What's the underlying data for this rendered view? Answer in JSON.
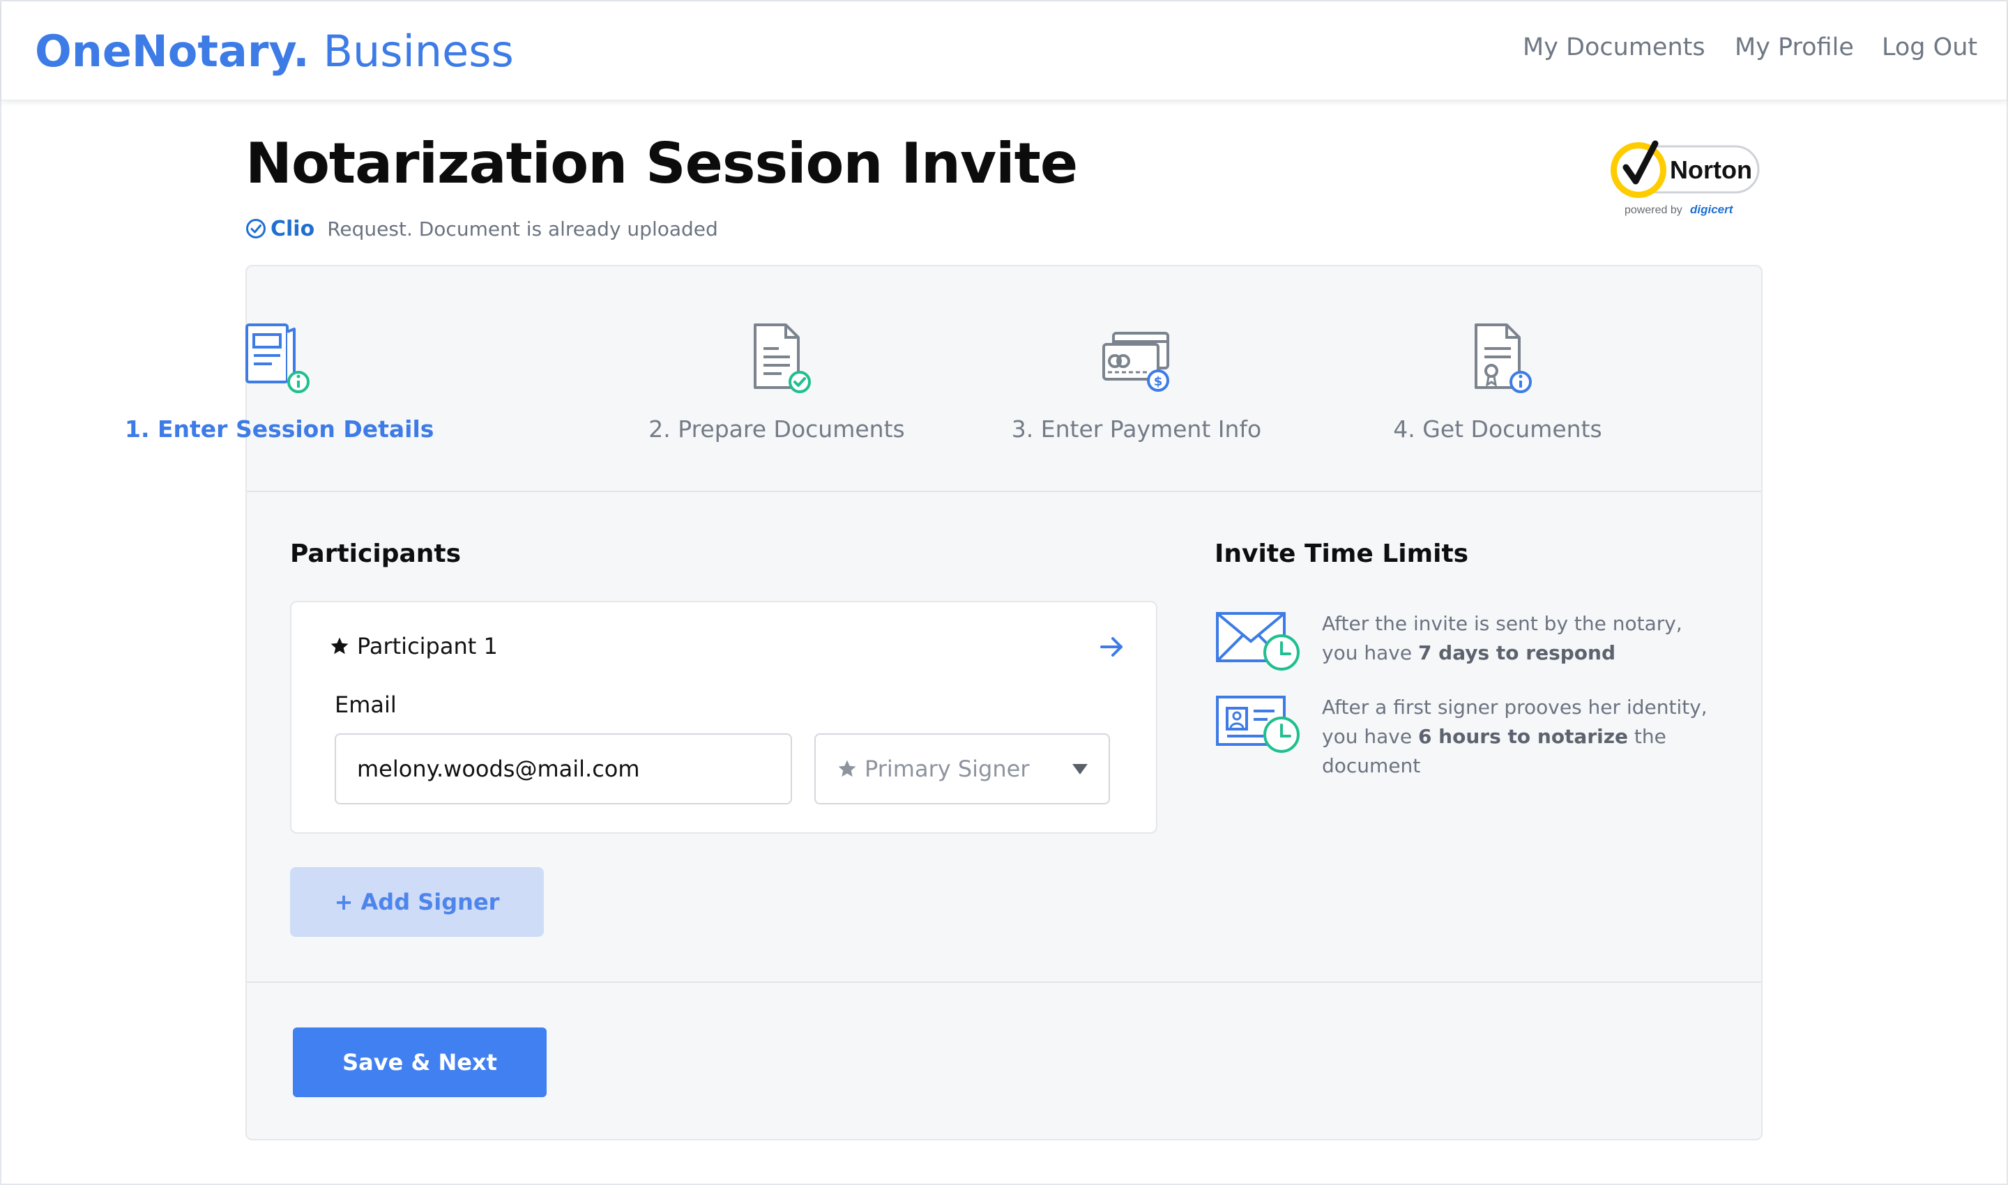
{
  "header": {
    "brand_bold": "OneNotary.",
    "brand_light": "Business",
    "nav": [
      "My Documents",
      "My Profile",
      "Log Out"
    ]
  },
  "page": {
    "title": "Notarization Session Invite",
    "source_logo": "Clio",
    "subtitle": "Request. Document is already uploaded",
    "badge_name": "Norton",
    "badge_powered": "powered by",
    "badge_partner": "digicert"
  },
  "steps": [
    {
      "label": "1. Enter Session Details",
      "icon": "session-details-icon",
      "active": true
    },
    {
      "label": "2. Prepare Documents",
      "icon": "prepare-documents-icon",
      "active": false
    },
    {
      "label": "3. Enter Payment Info",
      "icon": "payment-info-icon",
      "active": false
    },
    {
      "label": "4. Get Documents",
      "icon": "get-documents-icon",
      "active": false
    }
  ],
  "participants": {
    "title": "Participants",
    "items": [
      {
        "name": "Participant 1",
        "email_label": "Email",
        "email_value": "melony.woods@mail.com",
        "role": "Primary Signer"
      }
    ],
    "add_button": "+ Add Signer"
  },
  "limits": {
    "title": "Invite Time Limits",
    "items": [
      {
        "icon": "envelope-clock-icon",
        "pre": "After the invite is sent by the notary, you have ",
        "bold": "7 days to respond",
        "post": ""
      },
      {
        "icon": "id-card-clock-icon",
        "pre": "After a first signer prooves her identity, you have ",
        "bold": "6 hours to notarize",
        "post": " the document"
      }
    ]
  },
  "footer": {
    "save_button": "Save & Next"
  },
  "colors": {
    "accent": "#3d7be6",
    "success": "#1fbf8f",
    "primary_button": "#4180f0",
    "secondary_button_bg": "#cfdcf8",
    "card_bg": "#f6f7f9"
  }
}
